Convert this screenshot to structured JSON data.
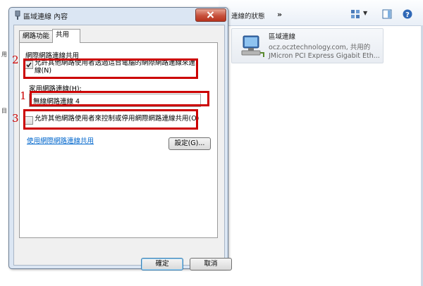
{
  "background_window": {
    "breadcrumb": "連線的狀態",
    "more_glyph": "»",
    "connection": {
      "name": "區域連線",
      "status": "ocz.ocztechnology.com, 共用的",
      "device": "JMicron PCI Express Gigabit Eth..."
    },
    "left_strip_chars": [
      "用",
      "目"
    ]
  },
  "dialog": {
    "title": "區域連線 內容",
    "tabs": [
      "網路功能",
      "共用"
    ],
    "group_label": "網際網路連線共用",
    "allow_sharing": {
      "checked": true,
      "label": "允許其他網路使用者透過這台電腦的網際網路連線來連線(N)"
    },
    "home_network_label": "家用網路連線(H):",
    "home_network_value": "無線網路連線 4",
    "allow_control": {
      "checked": false,
      "label": "允許其他網路使用者來控制或停用網際網路連線共用(O)"
    },
    "link_text": "使用網際網路連線共用",
    "settings_button": "設定(G)...",
    "ok_button": "確定",
    "cancel_button": "取消"
  },
  "annotations": {
    "labels": [
      "2",
      "1",
      "3"
    ],
    "color": "#cc0000"
  }
}
